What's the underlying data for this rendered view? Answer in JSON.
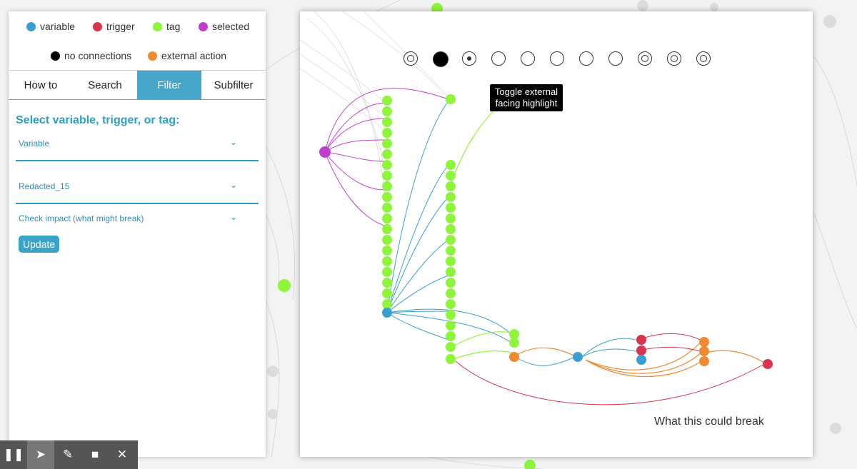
{
  "legend": [
    {
      "label": "variable",
      "color": "#3a9fd0"
    },
    {
      "label": "trigger",
      "color": "#d9344d"
    },
    {
      "label": "tag",
      "color": "#8ef53c"
    },
    {
      "label": "selected",
      "color": "#c03fcf"
    },
    {
      "label": "no connections",
      "color": "#000000"
    },
    {
      "label": "external action",
      "color": "#ef8a30"
    }
  ],
  "tabs": [
    "How to",
    "Search",
    "Filter",
    "Subfilter"
  ],
  "active_tab": "Filter",
  "filter": {
    "title": "Select variable, trigger, or tag:",
    "type_select": "Variable",
    "item_select": "Redacted_15",
    "mode_select": "Check impact (what might break)",
    "update_label": "Update"
  },
  "graph": {
    "tooltip": "Toggle external facing highlight",
    "bottom_label": "What this could break",
    "tool_icons": [
      "center-icon",
      "no-connections-icon",
      "target-icon",
      "wind-icon",
      "gauge-icon",
      "sparkle-icon",
      "wave-icon",
      "cluster-icon",
      "sun-icon",
      "zoom-in-icon",
      "zoom-out-icon"
    ]
  },
  "toolbar": {
    "buttons": [
      "pause-icon",
      "pointer-icon",
      "pen-icon",
      "eraser-icon",
      "close-icon"
    ]
  }
}
